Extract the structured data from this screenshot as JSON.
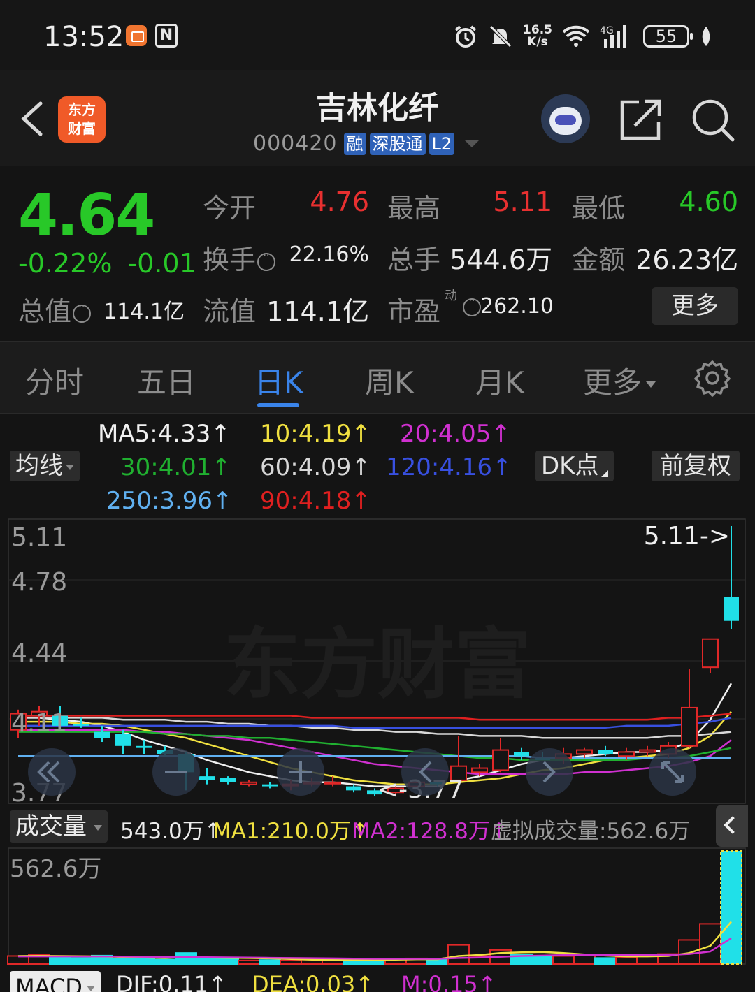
{
  "status_bar": {
    "time": "13:52",
    "speed_top": "16.5",
    "speed_bottom": "K/s",
    "network": "4G",
    "battery": "55"
  },
  "header": {
    "logo_line1": "东方",
    "logo_line2": "财富",
    "stock_name": "吉林化纤",
    "stock_code": "000420",
    "tags": [
      "融",
      "深股通",
      "L2"
    ]
  },
  "quote": {
    "price": "4.64",
    "change_pct": "-0.22%",
    "change_abs": "-0.01",
    "open_label": "今开",
    "open_value": "4.76",
    "high_label": "最高",
    "high_value": "5.11",
    "low_label": "最低",
    "low_value": "4.60",
    "turnover_label": "换手",
    "turnover_value": "22.16%",
    "volume_label": "总手",
    "volume_value": "544.6万",
    "amount_label": "金额",
    "amount_value": "26.23亿",
    "mktcap_label": "总值",
    "mktcap_value": "114.1亿",
    "float_label": "流值",
    "float_value": "114.1亿",
    "pe_label": "市盈",
    "pe_sup": "动",
    "pe_value": "262.10",
    "more_label": "更多"
  },
  "tabs": {
    "items": [
      "分时",
      "五日",
      "日K",
      "周K",
      "月K",
      "更多"
    ],
    "active": "日K"
  },
  "ma_legend": {
    "selector": "均线",
    "ma5": "MA5:4.33↑",
    "ma10": "10:4.19↑",
    "ma20": "20:4.05↑",
    "ma30": "30:4.01↑",
    "ma60": "60:4.09↑",
    "ma120": "120:4.16↑",
    "ma250": "250:3.96↑",
    "ma90": "90:4.18↑",
    "dk_label": "DK点",
    "fq_label": "前复权",
    "colors": {
      "ma5": "#f0f0f0",
      "ma10": "#f0e040",
      "ma20": "#d030d0",
      "ma30": "#20b030",
      "ma60": "#d8d8d8",
      "ma120": "#3850e0",
      "ma250": "#60b0f0",
      "ma90": "#e02020"
    }
  },
  "chart_data": {
    "type": "candlestick",
    "price_ticks": [
      "5.11",
      "4.78",
      "4.44",
      "4.11",
      "3.77"
    ],
    "ylim": [
      3.77,
      5.11
    ],
    "high_marker": "5.11->",
    "low_marker": "<-3.77",
    "watermark": "东方财富",
    "candles": [
      {
        "o": 4.1,
        "h": 4.2,
        "l": 4.06,
        "c": 4.18
      },
      {
        "o": 4.17,
        "h": 4.22,
        "l": 4.12,
        "c": 4.19
      },
      {
        "o": 4.17,
        "h": 4.22,
        "l": 4.1,
        "c": 4.12
      },
      {
        "o": 4.13,
        "h": 4.16,
        "l": 4.11,
        "c": 4.12
      },
      {
        "o": 4.09,
        "h": 4.12,
        "l": 4.04,
        "c": 4.06
      },
      {
        "o": 4.08,
        "h": 4.1,
        "l": 3.98,
        "c": 4.02
      },
      {
        "o": 4.02,
        "h": 4.05,
        "l": 3.98,
        "c": 4.01
      },
      {
        "o": 4.0,
        "h": 4.02,
        "l": 3.97,
        "c": 3.98
      },
      {
        "o": 3.98,
        "h": 3.99,
        "l": 3.8,
        "c": 3.89
      },
      {
        "o": 3.87,
        "h": 3.91,
        "l": 3.83,
        "c": 3.85
      },
      {
        "o": 3.86,
        "h": 3.87,
        "l": 3.83,
        "c": 3.84
      },
      {
        "o": 3.83,
        "h": 3.85,
        "l": 3.82,
        "c": 3.84
      },
      {
        "o": 3.83,
        "h": 3.84,
        "l": 3.81,
        "c": 3.82
      },
      {
        "o": 3.83,
        "h": 3.85,
        "l": 3.8,
        "c": 3.83
      },
      {
        "o": 3.84,
        "h": 3.86,
        "l": 3.82,
        "c": 3.84
      },
      {
        "o": 3.84,
        "h": 3.87,
        "l": 3.82,
        "c": 3.84
      },
      {
        "o": 3.82,
        "h": 3.83,
        "l": 3.79,
        "c": 3.8
      },
      {
        "o": 3.8,
        "h": 3.81,
        "l": 3.77,
        "c": 3.78
      },
      {
        "o": 3.79,
        "h": 3.82,
        "l": 3.77,
        "c": 3.81
      },
      {
        "o": 3.82,
        "h": 3.85,
        "l": 3.81,
        "c": 3.84
      },
      {
        "o": 3.84,
        "h": 3.85,
        "l": 3.82,
        "c": 3.83
      },
      {
        "o": 3.85,
        "h": 4.07,
        "l": 3.84,
        "c": 3.92
      },
      {
        "o": 3.89,
        "h": 3.93,
        "l": 3.87,
        "c": 3.91
      },
      {
        "o": 3.9,
        "h": 4.06,
        "l": 3.89,
        "c": 4.0
      },
      {
        "o": 3.99,
        "h": 4.01,
        "l": 3.95,
        "c": 3.97
      },
      {
        "o": 3.96,
        "h": 3.99,
        "l": 3.95,
        "c": 3.95
      },
      {
        "o": 3.96,
        "h": 4.01,
        "l": 3.93,
        "c": 3.98
      },
      {
        "o": 3.98,
        "h": 4.01,
        "l": 3.96,
        "c": 4.0
      },
      {
        "o": 4.0,
        "h": 4.02,
        "l": 3.97,
        "c": 3.98
      },
      {
        "o": 3.97,
        "h": 4.01,
        "l": 3.95,
        "c": 3.99
      },
      {
        "o": 3.99,
        "h": 4.02,
        "l": 3.97,
        "c": 4.0
      },
      {
        "o": 3.98,
        "h": 4.04,
        "l": 3.96,
        "c": 4.02
      },
      {
        "o": 4.02,
        "h": 4.4,
        "l": 4.01,
        "c": 4.21
      },
      {
        "o": 4.41,
        "h": 4.55,
        "l": 4.38,
        "c": 4.55
      },
      {
        "o": 4.76,
        "h": 5.11,
        "l": 4.6,
        "c": 4.64
      }
    ],
    "ma_lines": {
      "ma5": [
        4.16,
        4.16,
        4.15,
        4.14,
        4.12,
        4.09,
        4.05,
        4.02,
        3.99,
        3.95,
        3.92,
        3.89,
        3.87,
        3.85,
        3.84,
        3.84,
        3.83,
        3.82,
        3.82,
        3.82,
        3.82,
        3.85,
        3.87,
        3.9,
        3.93,
        3.95,
        3.96,
        3.97,
        3.98,
        3.99,
        3.99,
        4.0,
        4.04,
        4.15,
        4.33
      ],
      "ma10": [
        4.14,
        4.14,
        4.14,
        4.13,
        4.13,
        4.12,
        4.1,
        4.08,
        4.06,
        4.03,
        4.0,
        3.97,
        3.94,
        3.91,
        3.89,
        3.87,
        3.85,
        3.84,
        3.83,
        3.83,
        3.83,
        3.84,
        3.85,
        3.86,
        3.88,
        3.9,
        3.91,
        3.93,
        3.95,
        3.96,
        3.97,
        3.98,
        4.01,
        4.07,
        4.19
      ],
      "ma20": [
        4.1,
        4.1,
        4.1,
        4.1,
        4.1,
        4.1,
        4.09,
        4.09,
        4.08,
        4.07,
        4.06,
        4.05,
        4.03,
        4.01,
        3.99,
        3.97,
        3.95,
        3.93,
        3.92,
        3.91,
        3.9,
        3.89,
        3.88,
        3.88,
        3.88,
        3.88,
        3.88,
        3.89,
        3.89,
        3.9,
        3.91,
        3.92,
        3.94,
        3.97,
        4.05
      ],
      "ma30": [
        4.09,
        4.09,
        4.09,
        4.09,
        4.09,
        4.09,
        4.09,
        4.08,
        4.08,
        4.07,
        4.07,
        4.06,
        4.06,
        4.05,
        4.04,
        4.03,
        4.02,
        4.01,
        4.0,
        3.99,
        3.98,
        3.97,
        3.96,
        3.96,
        3.95,
        3.95,
        3.95,
        3.95,
        3.95,
        3.95,
        3.96,
        3.96,
        3.97,
        3.99,
        4.01
      ],
      "ma60": [
        4.16,
        4.16,
        4.16,
        4.16,
        4.16,
        4.15,
        4.15,
        4.15,
        4.14,
        4.14,
        4.13,
        4.13,
        4.12,
        4.12,
        4.11,
        4.11,
        4.1,
        4.1,
        4.09,
        4.09,
        4.08,
        4.08,
        4.07,
        4.07,
        4.07,
        4.06,
        4.06,
        4.06,
        4.06,
        4.06,
        4.06,
        4.07,
        4.07,
        4.08,
        4.09
      ],
      "ma120": [
        4.12,
        4.12,
        4.12,
        4.12,
        4.12,
        4.12,
        4.12,
        4.12,
        4.12,
        4.12,
        4.12,
        4.12,
        4.12,
        4.12,
        4.12,
        4.12,
        4.11,
        4.11,
        4.11,
        4.11,
        4.11,
        4.11,
        4.11,
        4.11,
        4.11,
        4.11,
        4.11,
        4.11,
        4.11,
        4.12,
        4.12,
        4.12,
        4.13,
        4.14,
        4.16
      ],
      "ma90": [
        4.17,
        4.17,
        4.17,
        4.17,
        4.17,
        4.17,
        4.17,
        4.17,
        4.17,
        4.17,
        4.17,
        4.17,
        4.17,
        4.17,
        4.16,
        4.16,
        4.16,
        4.16,
        4.16,
        4.16,
        4.16,
        4.16,
        4.15,
        4.15,
        4.15,
        4.15,
        4.15,
        4.15,
        4.15,
        4.15,
        4.15,
        4.16,
        4.16,
        4.17,
        4.18
      ],
      "ma250": [
        3.97,
        3.97,
        3.97,
        3.97,
        3.97,
        3.97,
        3.97,
        3.97,
        3.97,
        3.97,
        3.97,
        3.97,
        3.97,
        3.97,
        3.97,
        3.97,
        3.97,
        3.97,
        3.97,
        3.97,
        3.97,
        3.97,
        3.97,
        3.97,
        3.97,
        3.96,
        3.96,
        3.96,
        3.96,
        3.96,
        3.96,
        3.96,
        3.96,
        3.96,
        3.96
      ]
    },
    "volume_axis_label": "562.6万",
    "volume_ylim": [
      0,
      562.6
    ],
    "volumes": [
      40,
      45,
      38,
      30,
      42,
      25,
      28,
      22,
      55,
      30,
      26,
      18,
      20,
      18,
      22,
      24,
      20,
      22,
      26,
      28,
      22,
      95,
      40,
      70,
      45,
      35,
      40,
      45,
      30,
      35,
      40,
      50,
      120,
      200,
      562.6
    ],
    "vol_ma1": [
      40,
      41,
      40,
      39,
      38,
      35,
      32,
      30,
      34,
      32,
      31,
      30,
      28,
      25,
      22,
      21,
      20,
      20,
      22,
      24,
      24,
      40,
      45,
      55,
      58,
      60,
      55,
      48,
      42,
      38,
      38,
      40,
      55,
      90,
      210
    ],
    "vol_ma2": [
      38,
      38,
      38,
      38,
      38,
      37,
      36,
      35,
      35,
      34,
      33,
      32,
      31,
      30,
      29,
      28,
      27,
      26,
      26,
      26,
      26,
      30,
      32,
      36,
      40,
      42,
      44,
      45,
      45,
      44,
      44,
      45,
      50,
      62,
      128.8
    ]
  },
  "volume_legend": {
    "selector": "成交量",
    "vol": "543.0万↑",
    "ma1": "MA1:210.0万↑",
    "ma2": "MA2:128.8万↑",
    "virtual": "虚拟成交量:562.6万"
  },
  "macd_legend": {
    "selector": "MACD",
    "dif": "DIF:0.11↑",
    "dea": "DEA:0.03↑",
    "m": "M:0.15↑"
  }
}
